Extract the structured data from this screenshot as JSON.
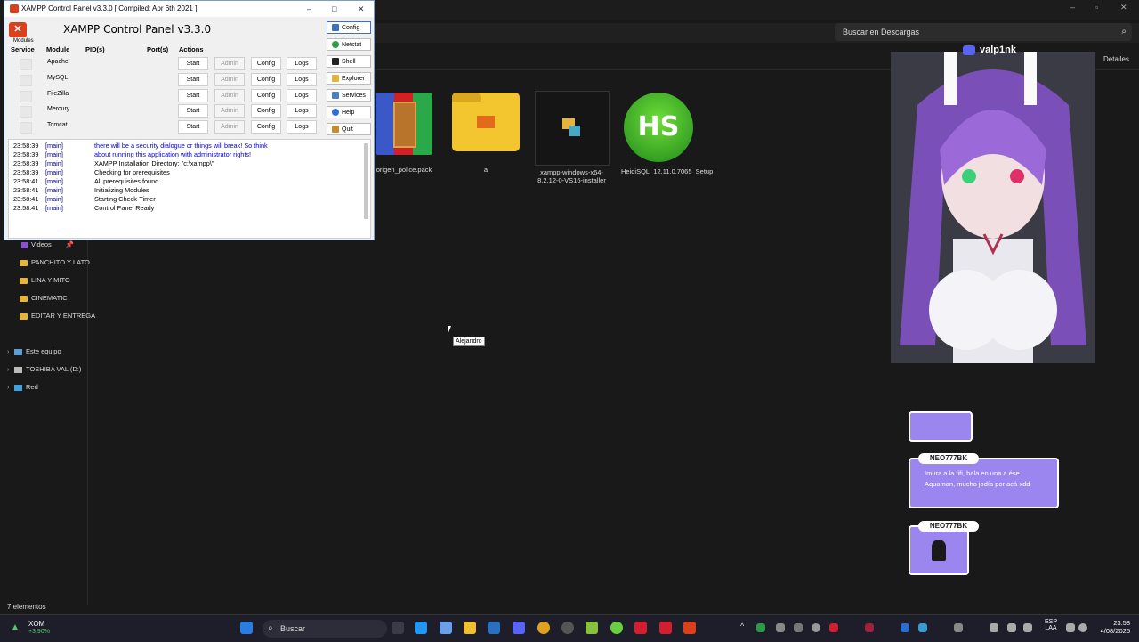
{
  "explorer": {
    "search_placeholder": "Buscar en Descargas",
    "details_label": "Detalles",
    "status": "7 elementos",
    "sidebar": [
      {
        "label": "Videos"
      },
      {
        "label": "PANCHITO Y LATO"
      },
      {
        "label": "LINA Y MITO"
      },
      {
        "label": "CINEMATIC"
      },
      {
        "label": "EDITAR Y ENTREGA"
      },
      {
        "label": "Este equipo"
      },
      {
        "label": "TOSHIBA VAL (D:)"
      },
      {
        "label": "Red"
      }
    ],
    "files": [
      {
        "name": "origen_police.pack"
      },
      {
        "name": "a"
      },
      {
        "name": "xampp-windows-x64-8.2.12-0-VS16-installer"
      },
      {
        "name": "HeidiSQL_12.11.0.7065_Setup"
      }
    ],
    "heidi_icon_text": "HS"
  },
  "xampp": {
    "window_title": "XAMPP Control Panel v3.3.0   [ Compiled: Apr 6th 2021 ]",
    "heading": "XAMPP Control Panel v3.3.0",
    "modules_label": "Modules",
    "columns": {
      "service": "Service",
      "module": "Module",
      "pid": "PID(s)",
      "port": "Port(s)",
      "actions": "Actions"
    },
    "modules": [
      {
        "name": "Apache",
        "start": "Start",
        "admin": "Admin",
        "config": "Config",
        "logs": "Logs"
      },
      {
        "name": "MySQL",
        "start": "Start",
        "admin": "Admin",
        "config": "Config",
        "logs": "Logs"
      },
      {
        "name": "FileZilla",
        "start": "Start",
        "admin": "Admin",
        "config": "Config",
        "logs": "Logs"
      },
      {
        "name": "Mercury",
        "start": "Start",
        "admin": "Admin",
        "config": "Config",
        "logs": "Logs"
      },
      {
        "name": "Tomcat",
        "start": "Start",
        "admin": "Admin",
        "config": "Config",
        "logs": "Logs"
      }
    ],
    "right_buttons": [
      {
        "label": "Config",
        "icon": "wrench-icon",
        "color": "#3d6fc4"
      },
      {
        "label": "Netstat",
        "icon": "globe-icon",
        "color": "#2f9e44"
      },
      {
        "label": "Shell",
        "icon": "terminal-icon",
        "color": "#222222"
      },
      {
        "label": "Explorer",
        "icon": "folder-icon",
        "color": "#e6b33b"
      },
      {
        "label": "Services",
        "icon": "services-icon",
        "color": "#4a7fc1"
      },
      {
        "label": "Help",
        "icon": "help-icon",
        "color": "#2f6fd6"
      },
      {
        "label": "Quit",
        "icon": "quit-icon",
        "color": "#c98a2b"
      }
    ],
    "log": [
      {
        "time": "23:58:39",
        "tag": "[main]",
        "msg": "there will be a security dialogue or things will break! So think",
        "blue": true
      },
      {
        "time": "23:58:39",
        "tag": "[main]",
        "msg": "about running this application with administrator rights!",
        "blue": true
      },
      {
        "time": "23:58:39",
        "tag": "[main]",
        "msg": "XAMPP Installation Directory: \"c:\\xampp\\\"",
        "blue": false
      },
      {
        "time": "23:58:39",
        "tag": "[main]",
        "msg": "Checking for prerequisites",
        "blue": false
      },
      {
        "time": "23:58:41",
        "tag": "[main]",
        "msg": "All prerequisites found",
        "blue": false
      },
      {
        "time": "23:58:41",
        "tag": "[main]",
        "msg": "Initializing Modules",
        "blue": false
      },
      {
        "time": "23:58:41",
        "tag": "[main]",
        "msg": "Starting Check-Timer",
        "blue": false
      },
      {
        "time": "23:58:41",
        "tag": "[main]",
        "msg": "Control Panel Ready",
        "blue": false
      }
    ]
  },
  "stream": {
    "discord_name": "valp1nk",
    "tooltip": "Alejandro",
    "chat": [
      {
        "user": "NEO777BK",
        "text": "!mura a la fifi, bala en una a ése Aquaman, mucho jodía por acá xdd"
      },
      {
        "user": "NEO777BK",
        "text": ""
      }
    ]
  },
  "taskbar": {
    "stock_name": "XOM",
    "stock_change": "+3.90%",
    "search_label": "Buscar",
    "lang_top": "ESP",
    "lang_bottom": "LAA",
    "time": "23:58",
    "date": "4/08/2025"
  },
  "colors": {
    "xampp_accent": "#d9411e",
    "chat_bg": "#9b86f0",
    "taskbar_bg": "#1e1e2a"
  }
}
